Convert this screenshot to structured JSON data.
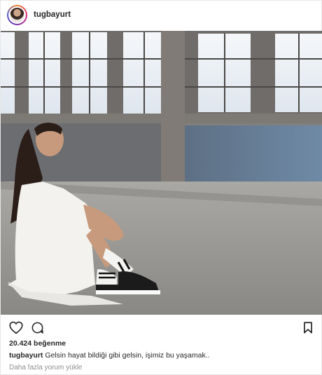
{
  "post": {
    "username": "tugbayurt",
    "likes_text": "20.424 beğenme",
    "caption_user": "tugbayurt",
    "caption_text": " Gelsin hayat bildiği gibi gelsin, işimiz bu yaşamak..",
    "more_comments": "Daha fazla yorum yükle"
  },
  "icons": {
    "like": "heart-icon",
    "comment": "comment-icon",
    "save": "bookmark-icon"
  },
  "colors": {
    "text": "#262626",
    "muted": "#8e8e8e",
    "border": "#e6e6e6"
  }
}
